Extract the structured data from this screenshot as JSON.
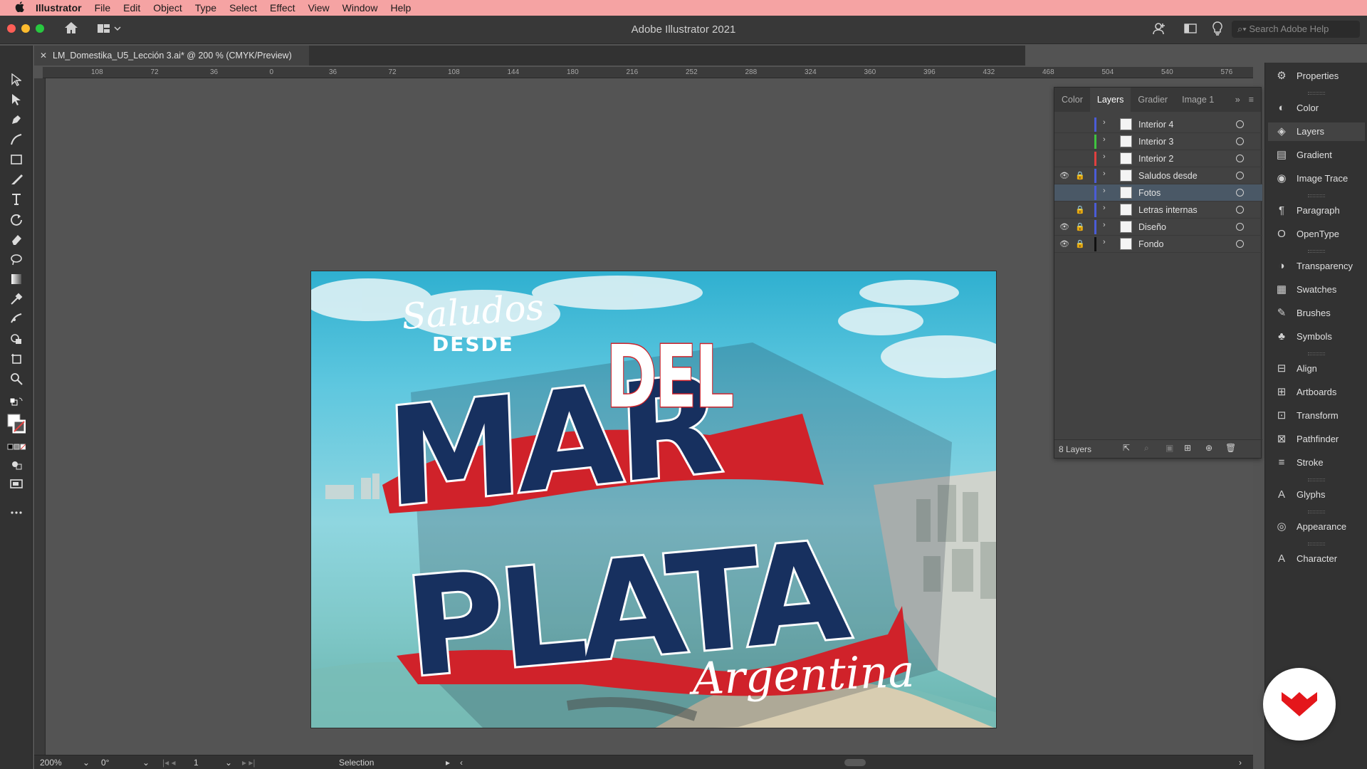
{
  "menubar": {
    "app_name": "Illustrator",
    "items": [
      "File",
      "Edit",
      "Object",
      "Type",
      "Select",
      "Effect",
      "View",
      "Window",
      "Help"
    ]
  },
  "window": {
    "title": "Adobe Illustrator 2021",
    "help_placeholder": "Search Adobe Help"
  },
  "document": {
    "tab_label": "LM_Domestika_U5_Lección 3.ai* @ 200 % (CMYK/Preview)"
  },
  "ruler": {
    "top_marks": [
      "108",
      "72",
      "36",
      "0",
      "36",
      "72",
      "108",
      "144",
      "180",
      "216",
      "252",
      "288",
      "324",
      "360",
      "396",
      "432",
      "468",
      "504",
      "540",
      "576"
    ]
  },
  "artwork": {
    "line1_script": "Saludos",
    "line1_caps": "DESDE",
    "word_mar": "MAR",
    "word_del": "DEL",
    "word_plata": "PLATA",
    "script_bottom": "Argentina",
    "colors": {
      "navy": "#17305f",
      "red": "#d0222a",
      "pink": "#f3a9a9",
      "white": "#ffffff"
    }
  },
  "layers_panel": {
    "tabs": [
      "Color",
      "Layers",
      "Gradier",
      "Image 1"
    ],
    "active_tab": "Layers",
    "layers": [
      {
        "name": "Interior 4",
        "color": "#4a5cd6",
        "visible": false,
        "locked": false,
        "selected": false
      },
      {
        "name": "Interior 3",
        "color": "#3fc43f",
        "visible": false,
        "locked": false,
        "selected": false
      },
      {
        "name": "Interior 2",
        "color": "#e0403f",
        "visible": false,
        "locked": false,
        "selected": false
      },
      {
        "name": "Saludos desde",
        "color": "#4a5cd6",
        "visible": true,
        "locked": true,
        "selected": false
      },
      {
        "name": "Fotos",
        "color": "#4a5cd6",
        "visible": false,
        "locked": false,
        "selected": true
      },
      {
        "name": "Letras internas",
        "color": "#4a5cd6",
        "visible": false,
        "locked": true,
        "selected": false
      },
      {
        "name": "Diseño",
        "color": "#4a5cd6",
        "visible": true,
        "locked": true,
        "selected": false
      },
      {
        "name": "Fondo",
        "color": "#111111",
        "visible": true,
        "locked": true,
        "selected": false
      }
    ],
    "count_label": "8 Layers"
  },
  "right_dock": {
    "items": [
      "Properties",
      "Color",
      "Layers",
      "Gradient",
      "Image Trace",
      "Paragraph",
      "OpenType",
      "Transparency",
      "Swatches",
      "Brushes",
      "Symbols",
      "Align",
      "Artboards",
      "Transform",
      "Pathfinder",
      "Stroke",
      "Glyphs",
      "Appearance",
      "Character"
    ],
    "active": "Layers"
  },
  "statusbar": {
    "zoom": "200%",
    "rotation": "0°",
    "artboard_number": "1",
    "tool": "Selection"
  }
}
